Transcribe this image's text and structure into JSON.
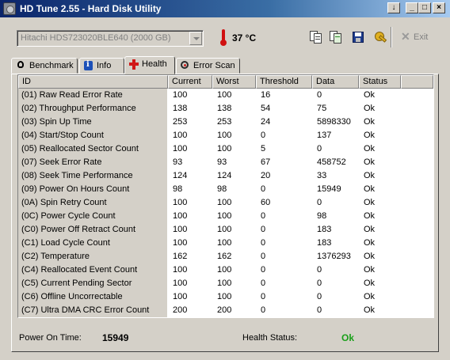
{
  "window": {
    "title": "HD Tune 2.55 - Hard Disk Utility"
  },
  "toolbar": {
    "drive": "Hitachi HDS723020BLE640 (2000 GB)",
    "temperature": "37 °C",
    "exit_label": "Exit"
  },
  "tabs": [
    {
      "label": "Benchmark",
      "icon": "benchmark-icon"
    },
    {
      "label": "Info",
      "icon": "info-icon"
    },
    {
      "label": "Health",
      "icon": "health-cross-icon"
    },
    {
      "label": "Error Scan",
      "icon": "error-scan-icon"
    }
  ],
  "active_tab": "Health",
  "table": {
    "columns": [
      "ID",
      "Current",
      "Worst",
      "Threshold",
      "Data",
      "Status"
    ],
    "rows": [
      [
        "(01) Raw Read Error Rate",
        "100",
        "100",
        "16",
        "0",
        "Ok"
      ],
      [
        "(02) Throughput Performance",
        "138",
        "138",
        "54",
        "75",
        "Ok"
      ],
      [
        "(03) Spin Up Time",
        "253",
        "253",
        "24",
        "5898330",
        "Ok"
      ],
      [
        "(04) Start/Stop Count",
        "100",
        "100",
        "0",
        "137",
        "Ok"
      ],
      [
        "(05) Reallocated Sector Count",
        "100",
        "100",
        "5",
        "0",
        "Ok"
      ],
      [
        "(07) Seek Error Rate",
        "93",
        "93",
        "67",
        "458752",
        "Ok"
      ],
      [
        "(08) Seek Time Performance",
        "124",
        "124",
        "20",
        "33",
        "Ok"
      ],
      [
        "(09) Power On Hours Count",
        "98",
        "98",
        "0",
        "15949",
        "Ok"
      ],
      [
        "(0A) Spin Retry Count",
        "100",
        "100",
        "60",
        "0",
        "Ok"
      ],
      [
        "(0C) Power Cycle Count",
        "100",
        "100",
        "0",
        "98",
        "Ok"
      ],
      [
        "(C0) Power Off Retract Count",
        "100",
        "100",
        "0",
        "183",
        "Ok"
      ],
      [
        "(C1) Load Cycle Count",
        "100",
        "100",
        "0",
        "183",
        "Ok"
      ],
      [
        "(C2) Temperature",
        "162",
        "162",
        "0",
        "1376293",
        "Ok"
      ],
      [
        "(C4) Reallocated Event Count",
        "100",
        "100",
        "0",
        "0",
        "Ok"
      ],
      [
        "(C5) Current Pending Sector",
        "100",
        "100",
        "0",
        "0",
        "Ok"
      ],
      [
        "(C6) Offline Uncorrectable",
        "100",
        "100",
        "0",
        "0",
        "Ok"
      ],
      [
        "(C7) Ultra DMA CRC Error Count",
        "200",
        "200",
        "0",
        "0",
        "Ok"
      ]
    ]
  },
  "footer": {
    "power_on_label": "Power On Time:",
    "power_on_value": "15949",
    "health_label": "Health Status:",
    "health_value": "Ok",
    "health_color": "#1aa01a"
  },
  "colors": {
    "title_gradient_start": "#0a246a",
    "title_gradient_end": "#a6caf0",
    "window_face": "#d4d0c8",
    "temperature_icon": "#d01010"
  }
}
